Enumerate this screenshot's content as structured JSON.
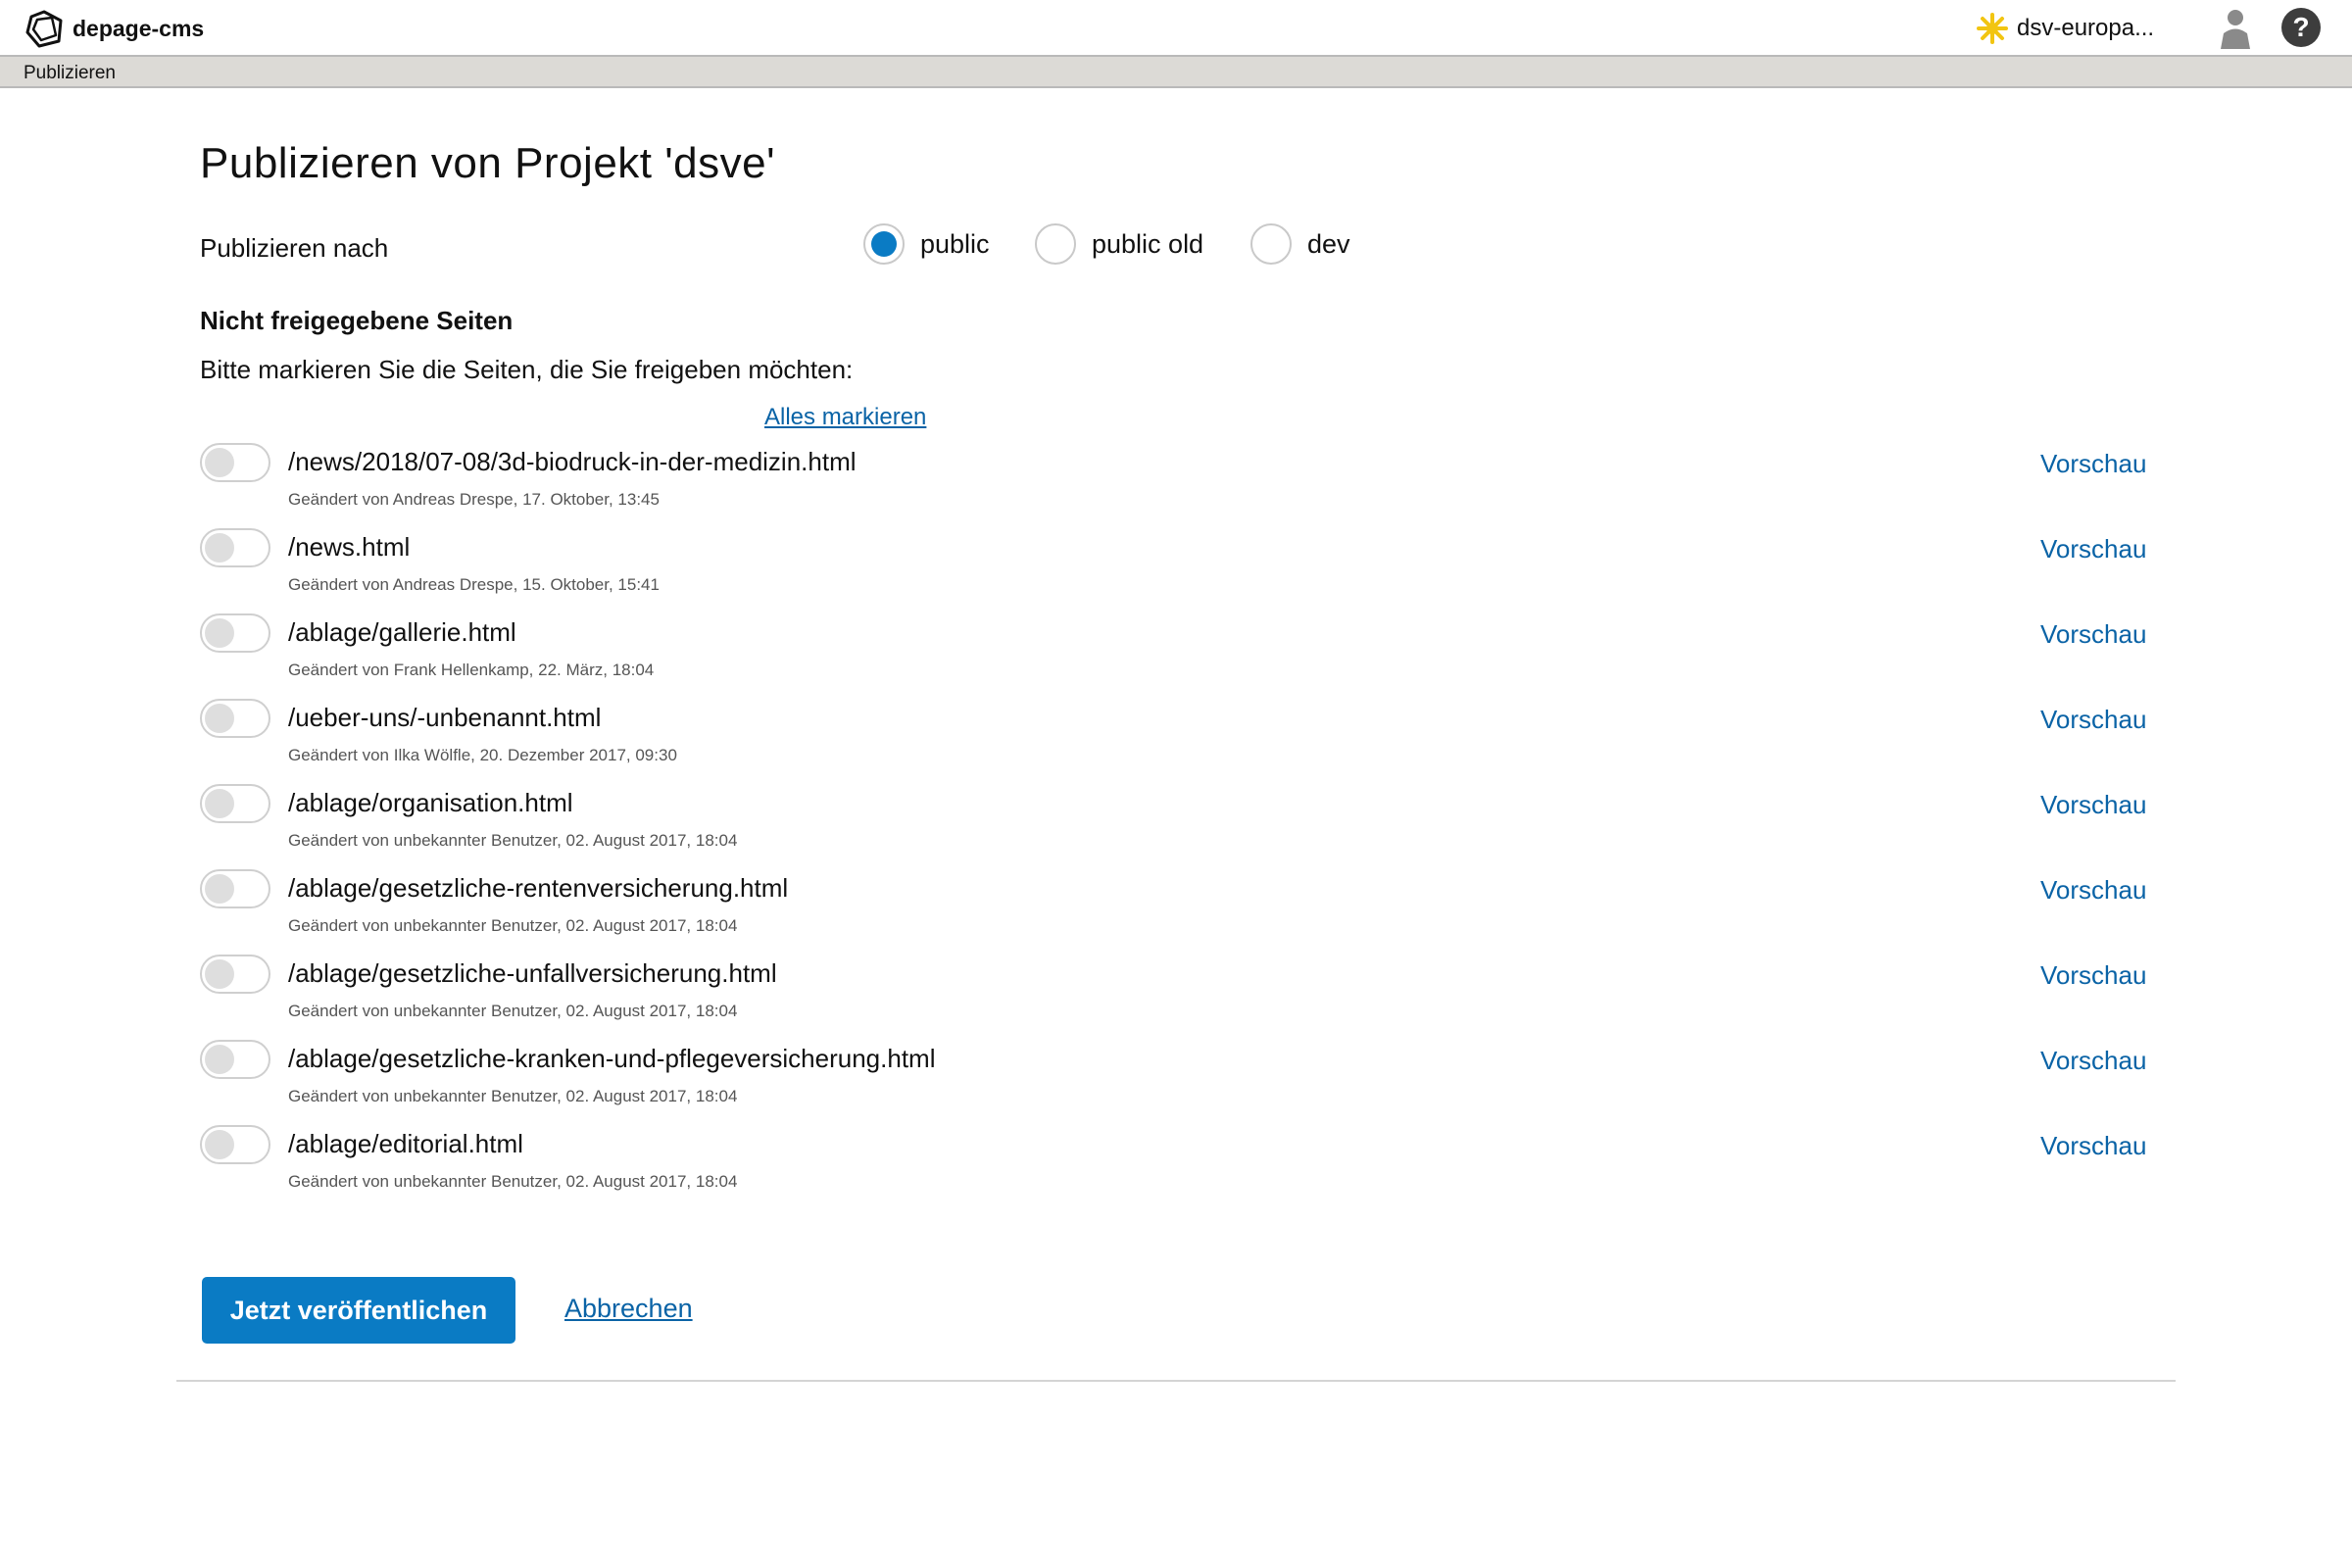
{
  "header": {
    "app_name": "depage-cms",
    "project_name": "dsv-europa...",
    "help_label": "?"
  },
  "toolbar": {
    "tab_label": "Publizieren"
  },
  "main": {
    "title": "Publizieren von Projekt 'dsve'",
    "target_label": "Publizieren nach",
    "targets": [
      {
        "label": "public",
        "checked": true
      },
      {
        "label": "public old",
        "checked": false
      },
      {
        "label": "dev",
        "checked": false
      }
    ],
    "section_heading": "Nicht freigegebene Seiten",
    "instruction": "Bitte markieren Sie die Seiten, die Sie freigeben möchten:",
    "mark_all_label": "Alles markieren",
    "preview_label": "Vorschau",
    "pages": [
      {
        "path": "/news/2018/07-08/3d-biodruck-in-der-medizin.html",
        "meta": "Geändert von Andreas Drespe, 17. Oktober, 13:45"
      },
      {
        "path": "/news.html",
        "meta": "Geändert von Andreas Drespe, 15. Oktober, 15:41"
      },
      {
        "path": "/ablage/gallerie.html",
        "meta": "Geändert von Frank Hellenkamp, 22. März, 18:04"
      },
      {
        "path": "/ueber-uns/-unbenannt.html",
        "meta": "Geändert von Ilka Wölfle, 20. Dezember 2017, 09:30"
      },
      {
        "path": "/ablage/organisation.html",
        "meta": "Geändert von unbekannter Benutzer, 02. August 2017, 18:04"
      },
      {
        "path": "/ablage/gesetzliche-rentenversicherung.html",
        "meta": "Geändert von unbekannter Benutzer, 02. August 2017, 18:04"
      },
      {
        "path": "/ablage/gesetzliche-unfallversicherung.html",
        "meta": "Geändert von unbekannter Benutzer, 02. August 2017, 18:04"
      },
      {
        "path": "/ablage/gesetzliche-kranken-und-pflegeversicherung.html",
        "meta": "Geändert von unbekannter Benutzer, 02. August 2017, 18:04"
      },
      {
        "path": "/ablage/editorial.html",
        "meta": "Geändert von unbekannter Benutzer, 02. August 2017, 18:04"
      }
    ],
    "publish_button": "Jetzt veröffentlichen",
    "cancel_label": "Abbrechen"
  },
  "colors": {
    "accent": "#0a7bc4",
    "link": "#0a63a6",
    "toolbar_bg": "#dcdad6",
    "project_icon": "#f2c511"
  }
}
